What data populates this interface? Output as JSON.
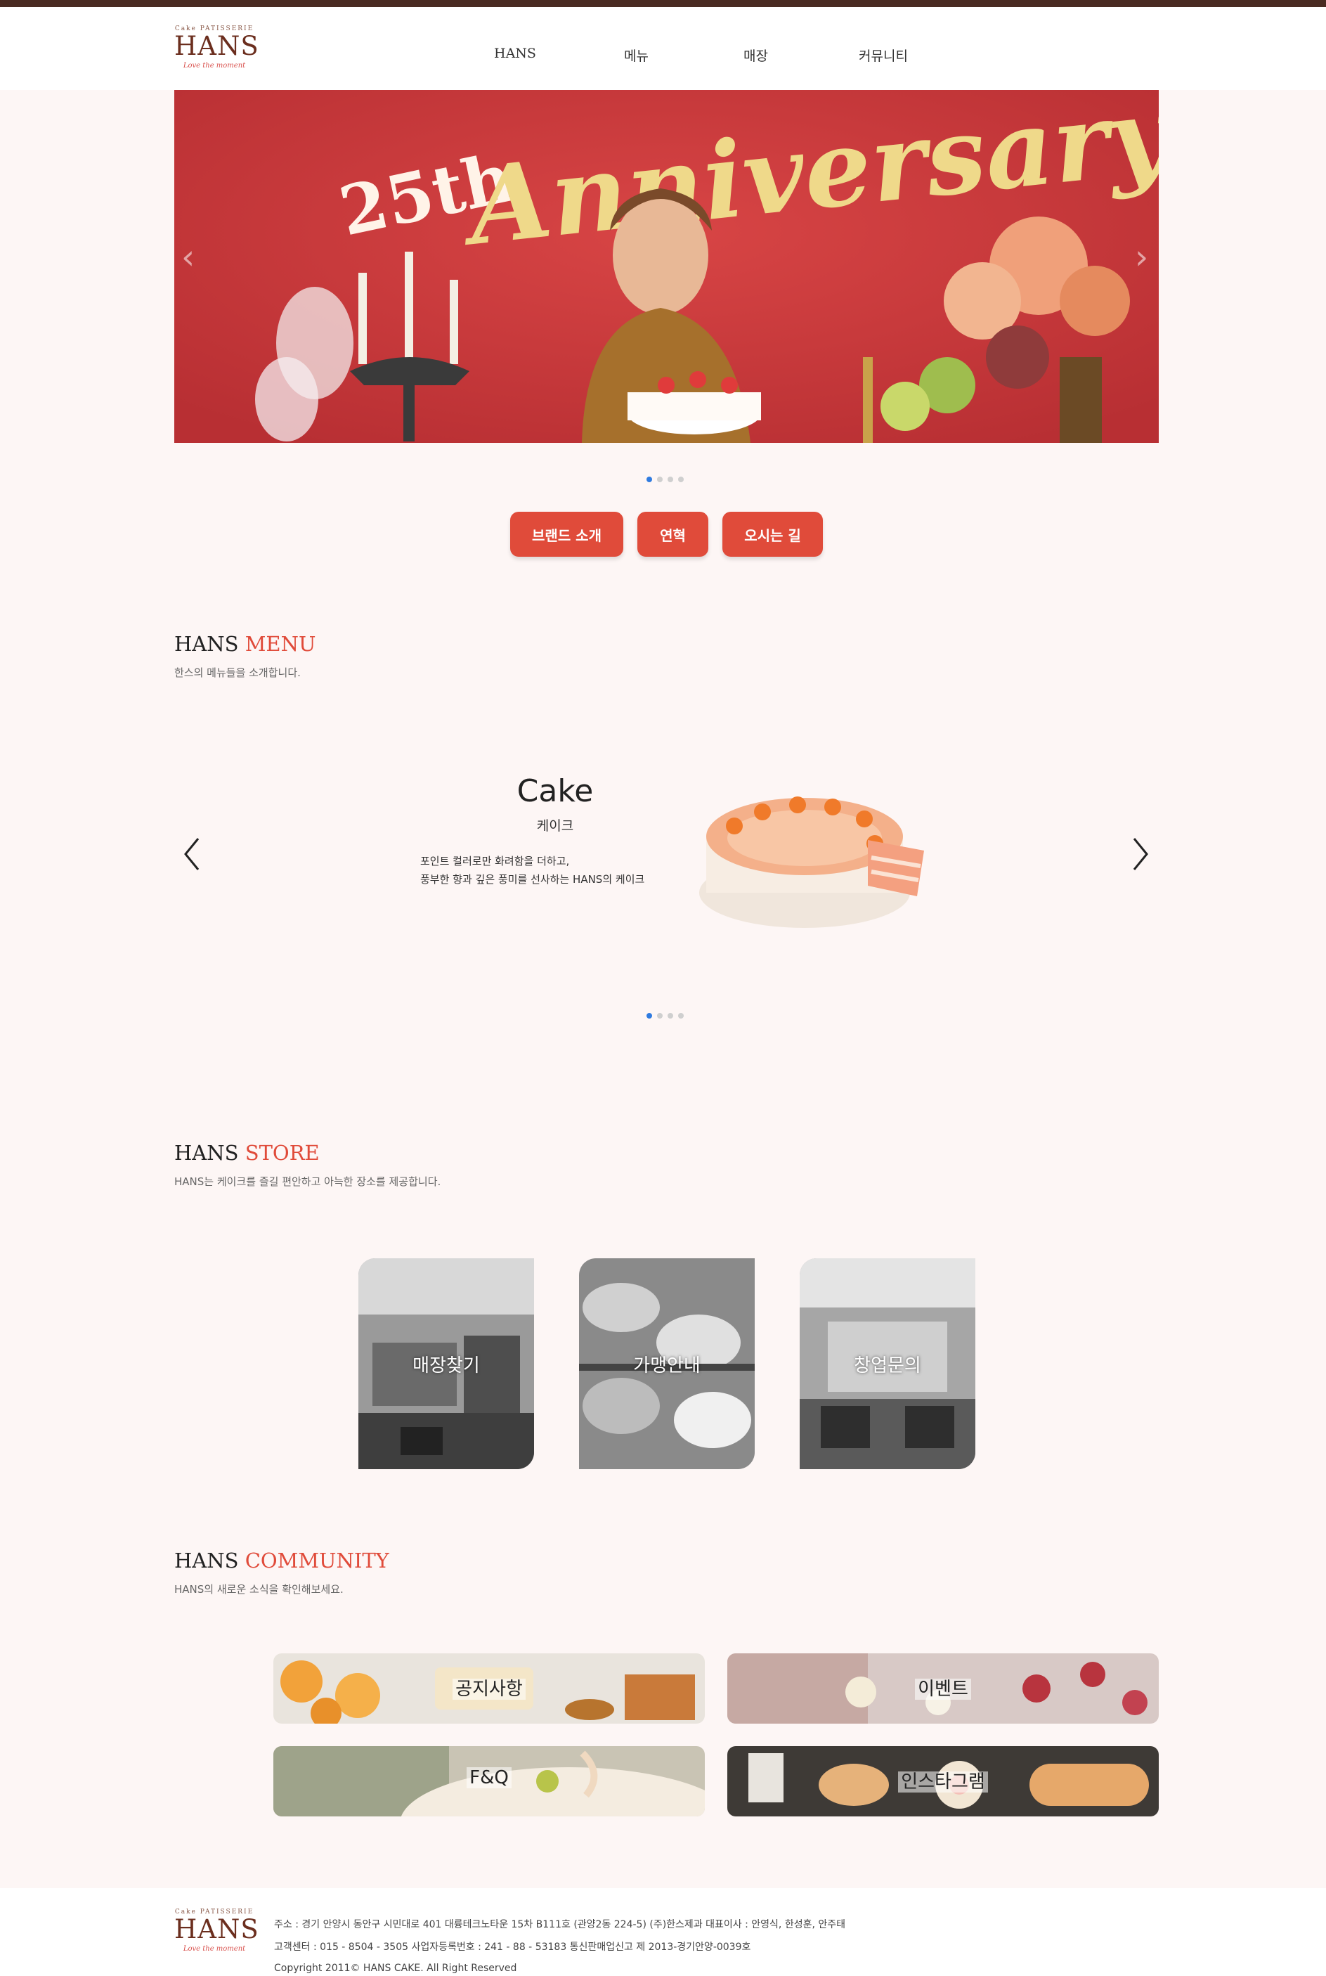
{
  "logo": {
    "small": "Cake PATISSERIE",
    "brand": "HANS",
    "tagline": "Love the moment"
  },
  "nav": [
    "HANS",
    "메뉴",
    "매장",
    "커뮤니티"
  ],
  "banner": {
    "headline_number": "25th",
    "headline_word": "Anniversary",
    "prev_icon": "chevron-left-icon",
    "next_icon": "chevron-right-icon"
  },
  "buttons": [
    "브랜드 소개",
    "연혁",
    "오시는 길"
  ],
  "menu_section": {
    "title_main": "HANS",
    "title_accent": "MENU",
    "subtitle": "한스의 메뉴들을 소개합니다.",
    "item": {
      "name": "Cake",
      "name_kr": "케이크",
      "desc_line1": "포인트 컬러로만 화려함을 더하고,",
      "desc_line2": "풍부한 향과 깊은 풍미를 선사하는 HANS의 케이크"
    }
  },
  "store_section": {
    "title_main": "HANS",
    "title_accent": "STORE",
    "subtitle": "HANS는 케이크를 즐길 편안하고 아늑한 장소를 제공합니다.",
    "cards": [
      "매장찾기",
      "가맹안내",
      "창업문의"
    ]
  },
  "community_section": {
    "title_main": "HANS",
    "title_accent": "COMMUNITY",
    "subtitle": "HANS의 새로운 소식을 확인해보세요.",
    "cards": [
      "공지사항",
      "이벤트",
      "F&Q",
      "인스타그램"
    ]
  },
  "footer": {
    "line1": "주소 : 경기 안양시 동안구 시민대로 401 대륭테크노타운 15차 B111호 (관양2동 224-5) (주)한스제과 대표이사 : 안영식, 한성훈, 안주태",
    "line2": "고객센터 : 015 - 8504 - 3505 사업자등록번호 : 241 - 88 - 53183 통신판매업신고 제 2013-경기안양-0039호",
    "copyright": "Copyright 2011© HANS CAKE. All Right Reserved"
  },
  "colors": {
    "accent": "#e04b3a",
    "brand": "#6b2e1e",
    "banner_bg": "#c93a3a",
    "dot_active": "#2f7be0"
  }
}
